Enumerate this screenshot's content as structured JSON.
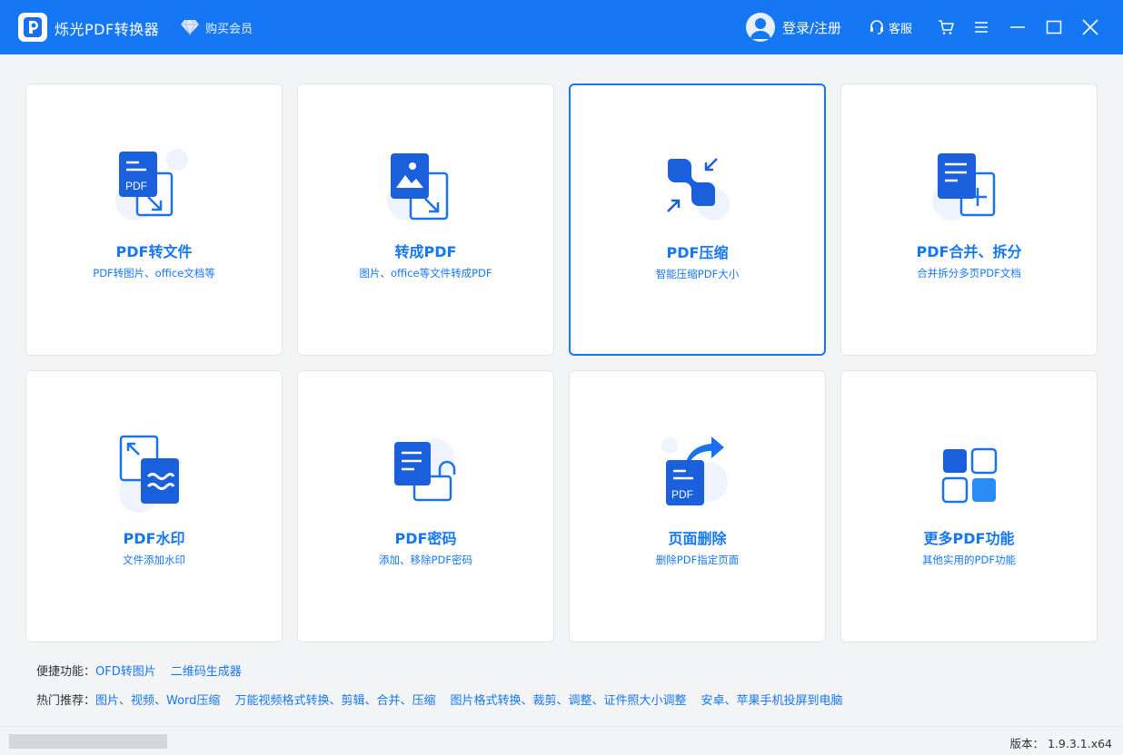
{
  "app": {
    "title": "烁光PDF转换器",
    "vip_label": "购买会员",
    "login_label": "登录/注册",
    "service_label": "客服"
  },
  "icons": {
    "logo": "pdf-logo-icon",
    "vip": "diamond-icon",
    "avatar": "user-avatar-icon",
    "service": "headset-icon",
    "cart": "cart-icon",
    "menu": "menu-icon",
    "minimize": "minimize-icon",
    "maximize": "maximize-icon",
    "close": "close-icon"
  },
  "colors": {
    "brand": "#1677f5",
    "card_border": "#e3e5ea",
    "background": "#f3f4f6"
  },
  "cards": [
    {
      "title": "PDF转文件",
      "subtitle": "PDF转图片、office文档等",
      "icon": "pdf-to-file-icon",
      "selected": false
    },
    {
      "title": "转成PDF",
      "subtitle": "图片、office等文件转成PDF",
      "icon": "image-to-pdf-icon",
      "selected": false
    },
    {
      "title": "PDF压缩",
      "subtitle": "智能压缩PDF大小",
      "icon": "compress-icon",
      "selected": true
    },
    {
      "title": "PDF合并、拆分",
      "subtitle": "合并拆分多页PDF文档",
      "icon": "merge-split-icon",
      "selected": false
    },
    {
      "title": "PDF水印",
      "subtitle": "文件添加水印",
      "icon": "watermark-icon",
      "selected": false
    },
    {
      "title": "PDF密码",
      "subtitle": "添加、移除PDF密码",
      "icon": "lock-icon",
      "selected": false
    },
    {
      "title": "页面删除",
      "subtitle": "删除PDF指定页面",
      "icon": "page-delete-icon",
      "selected": false
    },
    {
      "title": "更多PDF功能",
      "subtitle": "其他实用的PDF功能",
      "icon": "more-features-icon",
      "selected": false
    }
  ],
  "quick": {
    "label": "便捷功能：",
    "links": [
      "OFD转图片",
      "二维码生成器"
    ]
  },
  "hot": {
    "label": "热门推荐：",
    "links": [
      "图片、视频、Word压缩",
      "万能视频格式转换、剪辑、合并、压缩",
      "图片格式转换、裁剪、调整、证件照大小调整",
      "安卓、苹果手机投屏到电脑"
    ]
  },
  "status": {
    "version_label": "版本：",
    "version": "1.9.3.1.x64"
  }
}
